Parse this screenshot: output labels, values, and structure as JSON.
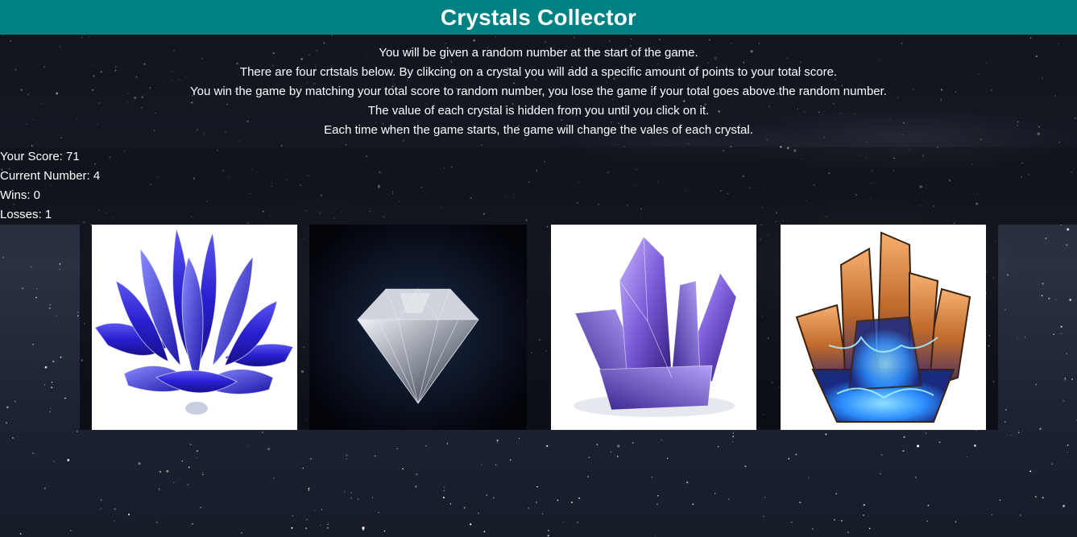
{
  "header": {
    "title": "Crystals Collector"
  },
  "instructions": [
    "You will be given a random number at the start of the game.",
    "There are four crtstals below. By clikcing on a crystal you will add a specific amount of points to your total score.",
    "You win the game by matching your total score to random number, you lose the game if your total goes above the random number.",
    "The value of each crystal is hidden from you until you click on it.",
    "Each time when the game starts, the game will change the vales of each crystal."
  ],
  "stats": {
    "score_label": "Your Score: 71",
    "current_label": "Current Number: 4",
    "wins_label": "Wins: 0",
    "losses_label": "Losses: 1"
  },
  "crystals": [
    {
      "icon": "blue-lotus-crystal-icon",
      "color": "#2a1fd0"
    },
    {
      "icon": "diamond-icon",
      "color": "#c8ccd4"
    },
    {
      "icon": "purple-crystal-cluster-icon",
      "color": "#7a5ad8"
    },
    {
      "icon": "orange-blue-crystal-icon",
      "color": "#e08a3a"
    }
  ],
  "theme": {
    "header_bg": "#008181",
    "text": "#ffffff"
  }
}
